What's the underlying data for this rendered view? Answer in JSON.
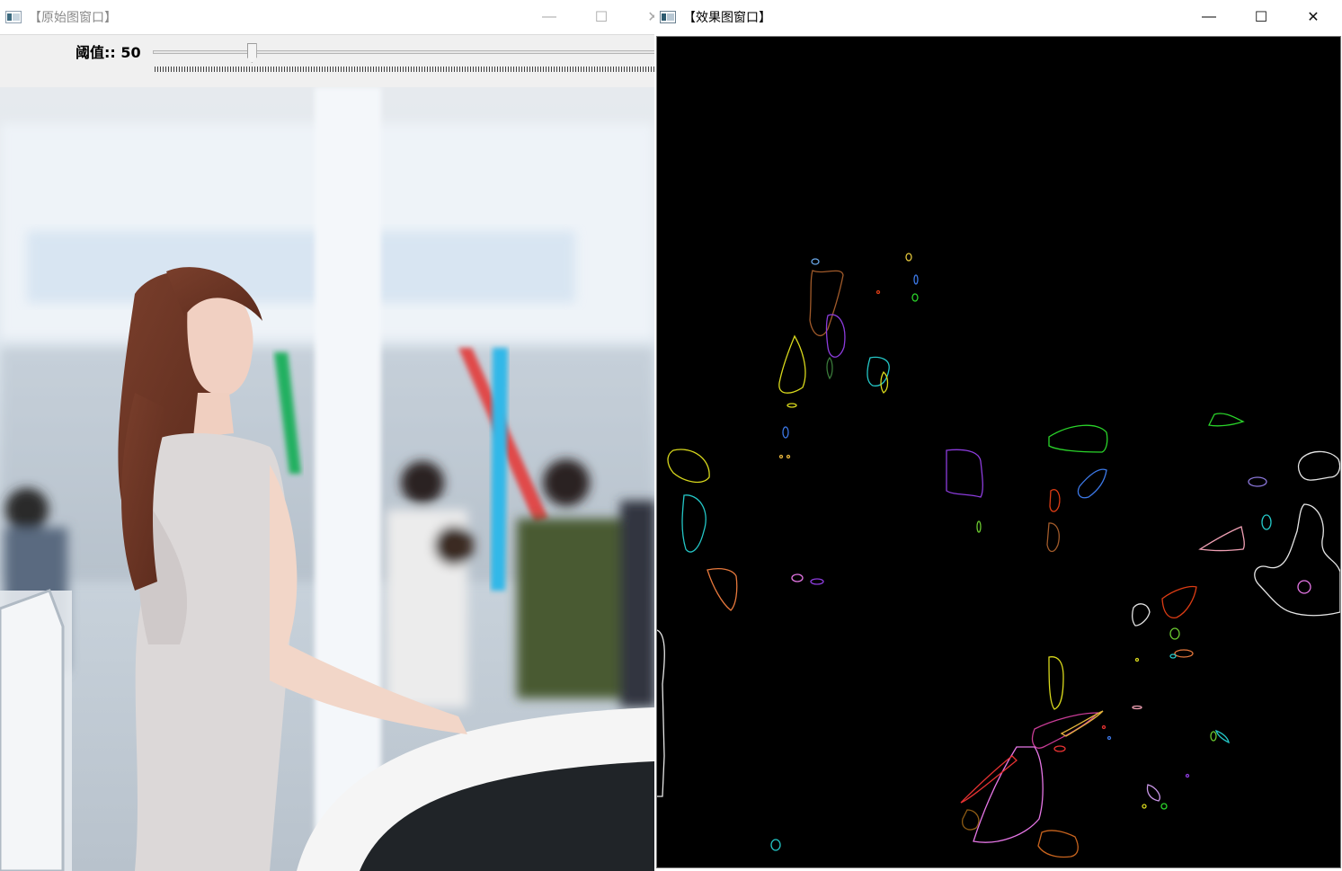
{
  "windows": {
    "original": {
      "title": "【原始图窗口】",
      "controls": {
        "minimize": "—",
        "maximize": "☐",
        "close": "✕"
      },
      "trackbar": {
        "label": "阈值:: 50",
        "value": 50,
        "max": 255
      }
    },
    "effect": {
      "title": "【效果图窗口】",
      "controls": {
        "minimize": "—",
        "maximize": "☐",
        "close": "✕"
      }
    }
  },
  "colors": {
    "canvas_background": "#000000",
    "contour_colors": [
      "#d8d81c",
      "#8c3cdc",
      "#24c6c6",
      "#2ad42a",
      "#dc3c14",
      "#e6b43c",
      "#e676e6",
      "#3c78e6",
      "#e6e6e6",
      "#c83232"
    ]
  }
}
